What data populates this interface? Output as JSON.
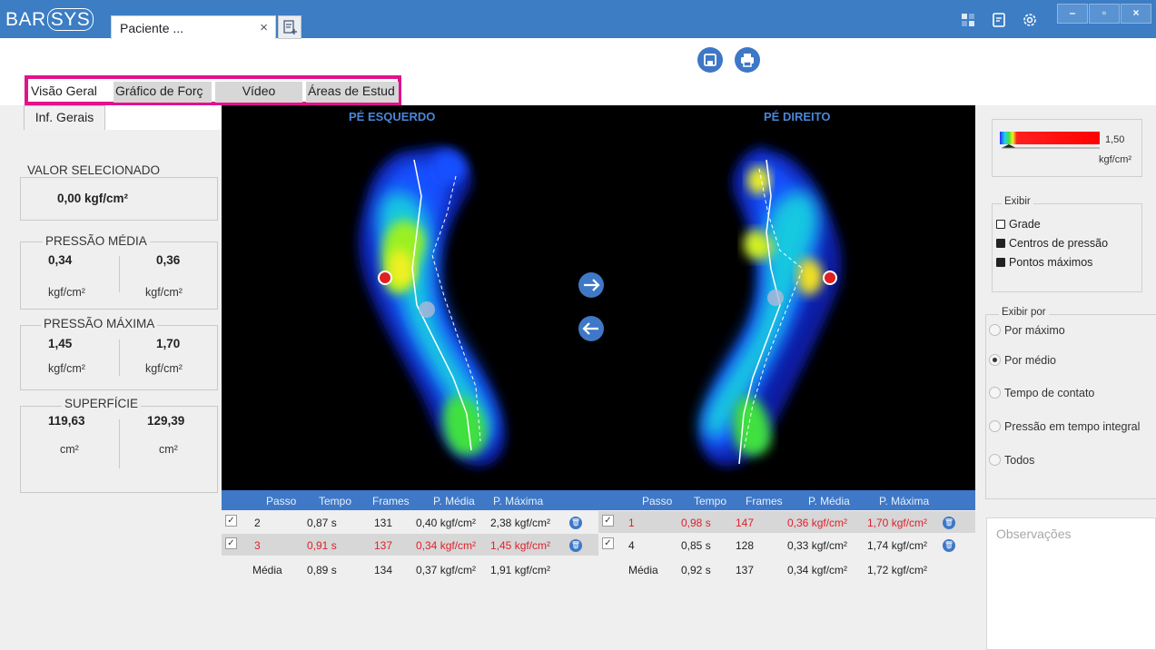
{
  "app": {
    "logo_left": "BAR",
    "logo_right": "SYS",
    "patient_tab": "Paciente ...",
    "close_glyph": "×",
    "window_buttons": [
      "–",
      "▫",
      "×"
    ]
  },
  "main_tabs": [
    "Visão Geral",
    "Gráfico de Forç",
    "Vídeo",
    "Áreas de Estud"
  ],
  "left": {
    "info_tab": "Inf. Gerais",
    "selected": {
      "title": "VALOR SELECIONADO",
      "value": "0,00 kgf/cm²"
    },
    "avg_pressure": {
      "title": "PRESSÃO MÉDIA",
      "left": "0,34",
      "right": "0,36",
      "unit": "kgf/cm²"
    },
    "max_pressure": {
      "title": "PRESSÃO MÁXIMA",
      "left": "1,45",
      "right": "1,70",
      "unit": "kgf/cm²"
    },
    "surface": {
      "title": "SUPERFÍCIE",
      "left": "119,63",
      "right": "129,39",
      "unit": "cm²"
    }
  },
  "scan": {
    "left_title": "PÉ ESQUERDO",
    "right_title": "PÉ DIREITO"
  },
  "table": {
    "headers": [
      "Passo",
      "Tempo",
      "Frames",
      "P. Média",
      "P. Máxima"
    ],
    "left_rows": [
      {
        "passo": "2",
        "tempo": "0,87 s",
        "frames": "131",
        "media": "0,40 kgf/cm²",
        "maxima": "2,38 kgf/cm²",
        "checked": "✓"
      },
      {
        "passo": "3",
        "tempo": "0,91 s",
        "frames": "137",
        "media": "0,34 kgf/cm²",
        "maxima": "1,45 kgf/cm²",
        "checked": "✓"
      }
    ],
    "left_avg": {
      "label": "Média",
      "tempo": "0,89 s",
      "frames": "134",
      "media": "0,37 kgf/cm²",
      "maxima": "1,91 kgf/cm²"
    },
    "right_rows": [
      {
        "passo": "1",
        "tempo": "0,98 s",
        "frames": "147",
        "media": "0,36 kgf/cm²",
        "maxima": "1,70 kgf/cm²",
        "checked": "✓"
      },
      {
        "passo": "4",
        "tempo": "0,85 s",
        "frames": "128",
        "media": "0,33 kgf/cm²",
        "maxima": "1,74 kgf/cm²",
        "checked": "✓"
      }
    ],
    "right_avg": {
      "label": "Média",
      "tempo": "0,92 s",
      "frames": "137",
      "media": "0,34 kgf/cm²",
      "maxima": "1,72 kgf/cm²"
    }
  },
  "right": {
    "scale_value": "1,50",
    "scale_unit": "kgf/cm²",
    "exibir_title": "Exibir",
    "exibir_options": [
      {
        "label": "Grade",
        "checked": false
      },
      {
        "label": "Centros de pressão",
        "checked": true
      },
      {
        "label": "Pontos máximos",
        "checked": true
      }
    ],
    "exibir_por_title": "Exibir por",
    "exibir_por_options": [
      "Por máximo",
      "Por médio",
      "Tempo de contato",
      "Pressão em tempo integral",
      "Todos"
    ],
    "selected_index": 1,
    "obs_placeholder": "Observações"
  },
  "colors": {
    "titlebar": "#3c7dc4",
    "accent": "#3e78c6",
    "tab_highlight": "#e0138c",
    "row_red": "#e0202a"
  }
}
